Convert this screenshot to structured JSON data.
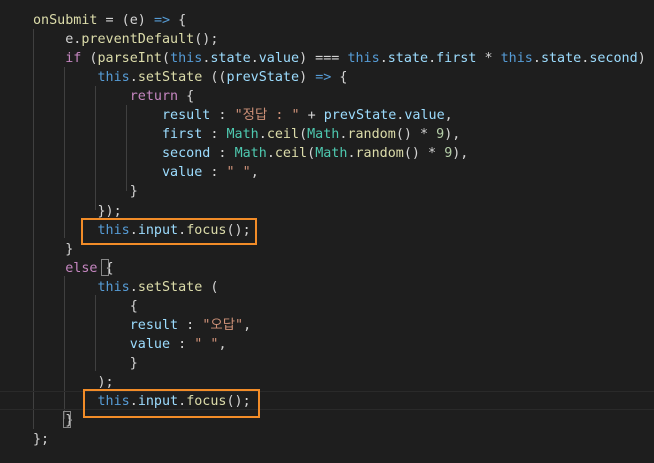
{
  "editor": {
    "language": "javascript",
    "theme": "dark",
    "lines": [
      [
        [
          "tok-fn",
          "onSubmit"
        ],
        [
          "tok-op",
          " = (e) "
        ],
        [
          "tok-kw",
          "=>"
        ],
        [
          "tok-op",
          " {"
        ]
      ],
      [
        [
          "tok-op",
          "    e."
        ],
        [
          "tok-fn",
          "preventDefault"
        ],
        [
          "tok-op",
          "();"
        ]
      ],
      [
        [
          "tok-op",
          "    "
        ],
        [
          "tok-ctrl",
          "if"
        ],
        [
          "tok-op",
          " ("
        ],
        [
          "tok-fn",
          "parseInt"
        ],
        [
          "tok-op",
          "("
        ],
        [
          "tok-kw",
          "this"
        ],
        [
          "tok-op",
          "."
        ],
        [
          "tok-id",
          "state"
        ],
        [
          "tok-op",
          "."
        ],
        [
          "tok-id",
          "value"
        ],
        [
          "tok-op",
          ") === "
        ],
        [
          "tok-kw",
          "this"
        ],
        [
          "tok-op",
          "."
        ],
        [
          "tok-id",
          "state"
        ],
        [
          "tok-op",
          "."
        ],
        [
          "tok-id",
          "first"
        ],
        [
          "tok-op",
          " * "
        ],
        [
          "tok-kw",
          "this"
        ],
        [
          "tok-op",
          "."
        ],
        [
          "tok-id",
          "state"
        ],
        [
          "tok-op",
          "."
        ],
        [
          "tok-id",
          "second"
        ],
        [
          "tok-op",
          ") {"
        ]
      ],
      [
        [
          "tok-op",
          "        "
        ],
        [
          "tok-kw",
          "this"
        ],
        [
          "tok-op",
          "."
        ],
        [
          "tok-fn",
          "setState"
        ],
        [
          "tok-op",
          " (("
        ],
        [
          "tok-id",
          "prevState"
        ],
        [
          "tok-op",
          ") "
        ],
        [
          "tok-kw",
          "=>"
        ],
        [
          "tok-op",
          " {"
        ]
      ],
      [
        [
          "tok-op",
          "            "
        ],
        [
          "tok-ctrl",
          "return"
        ],
        [
          "tok-op",
          " {"
        ]
      ],
      [
        [
          "tok-op",
          "                "
        ],
        [
          "tok-id",
          "result"
        ],
        [
          "tok-op",
          " : "
        ],
        [
          "tok-str",
          "\"정답 : \""
        ],
        [
          "tok-op",
          " + "
        ],
        [
          "tok-id",
          "prevState"
        ],
        [
          "tok-op",
          "."
        ],
        [
          "tok-id",
          "value"
        ],
        [
          "tok-op",
          ","
        ]
      ],
      [
        [
          "tok-op",
          "                "
        ],
        [
          "tok-id",
          "first"
        ],
        [
          "tok-op",
          " : "
        ],
        [
          "tok-cls",
          "Math"
        ],
        [
          "tok-op",
          "."
        ],
        [
          "tok-fn",
          "ceil"
        ],
        [
          "tok-op",
          "("
        ],
        [
          "tok-cls",
          "Math"
        ],
        [
          "tok-op",
          "."
        ],
        [
          "tok-fn",
          "random"
        ],
        [
          "tok-op",
          "() * "
        ],
        [
          "tok-num",
          "9"
        ],
        [
          "tok-op",
          "),"
        ]
      ],
      [
        [
          "tok-op",
          "                "
        ],
        [
          "tok-id",
          "second"
        ],
        [
          "tok-op",
          " : "
        ],
        [
          "tok-cls",
          "Math"
        ],
        [
          "tok-op",
          "."
        ],
        [
          "tok-fn",
          "ceil"
        ],
        [
          "tok-op",
          "("
        ],
        [
          "tok-cls",
          "Math"
        ],
        [
          "tok-op",
          "."
        ],
        [
          "tok-fn",
          "random"
        ],
        [
          "tok-op",
          "() * "
        ],
        [
          "tok-num",
          "9"
        ],
        [
          "tok-op",
          "),"
        ]
      ],
      [
        [
          "tok-op",
          "                "
        ],
        [
          "tok-id",
          "value"
        ],
        [
          "tok-op",
          " : "
        ],
        [
          "tok-str",
          "\" \""
        ],
        [
          "tok-op",
          ","
        ]
      ],
      [
        [
          "tok-op",
          "            }"
        ]
      ],
      [
        [
          "tok-op",
          "        });"
        ]
      ],
      [
        [
          "tok-op",
          "        "
        ],
        [
          "tok-kw",
          "this"
        ],
        [
          "tok-op",
          "."
        ],
        [
          "tok-id",
          "input"
        ],
        [
          "tok-op",
          "."
        ],
        [
          "tok-fn",
          "focus"
        ],
        [
          "tok-op",
          "();"
        ]
      ],
      [
        [
          "tok-op",
          "    }"
        ]
      ],
      [
        [
          "tok-op",
          "    "
        ],
        [
          "tok-ctrl",
          "else"
        ],
        [
          "tok-op",
          " {"
        ]
      ],
      [
        [
          "tok-op",
          "        "
        ],
        [
          "tok-kw",
          "this"
        ],
        [
          "tok-op",
          "."
        ],
        [
          "tok-fn",
          "setState"
        ],
        [
          "tok-op",
          " ("
        ]
      ],
      [
        [
          "tok-op",
          "            {"
        ]
      ],
      [
        [
          "tok-op",
          "            "
        ],
        [
          "tok-id",
          "result"
        ],
        [
          "tok-op",
          " : "
        ],
        [
          "tok-str",
          "\"오답\""
        ],
        [
          "tok-op",
          ","
        ]
      ],
      [
        [
          "tok-op",
          "            "
        ],
        [
          "tok-id",
          "value"
        ],
        [
          "tok-op",
          " : "
        ],
        [
          "tok-str",
          "\" \""
        ],
        [
          "tok-op",
          ","
        ]
      ],
      [
        [
          "tok-op",
          "            }"
        ]
      ],
      [
        [
          "tok-op",
          "        );"
        ]
      ],
      [
        [
          "tok-op",
          "        "
        ],
        [
          "tok-kw",
          "this"
        ],
        [
          "tok-op",
          "."
        ],
        [
          "tok-id",
          "input"
        ],
        [
          "tok-op",
          "."
        ],
        [
          "tok-fn",
          "focus"
        ],
        [
          "tok-op",
          "();"
        ]
      ],
      [
        [
          "tok-op",
          "    }"
        ]
      ],
      [
        [
          "tok-op",
          "};"
        ]
      ]
    ]
  },
  "annotations": {
    "color": "#f28c28",
    "boxes": [
      "this.input.focus(); (if branch)",
      "this.input.focus(); (else branch)"
    ]
  }
}
